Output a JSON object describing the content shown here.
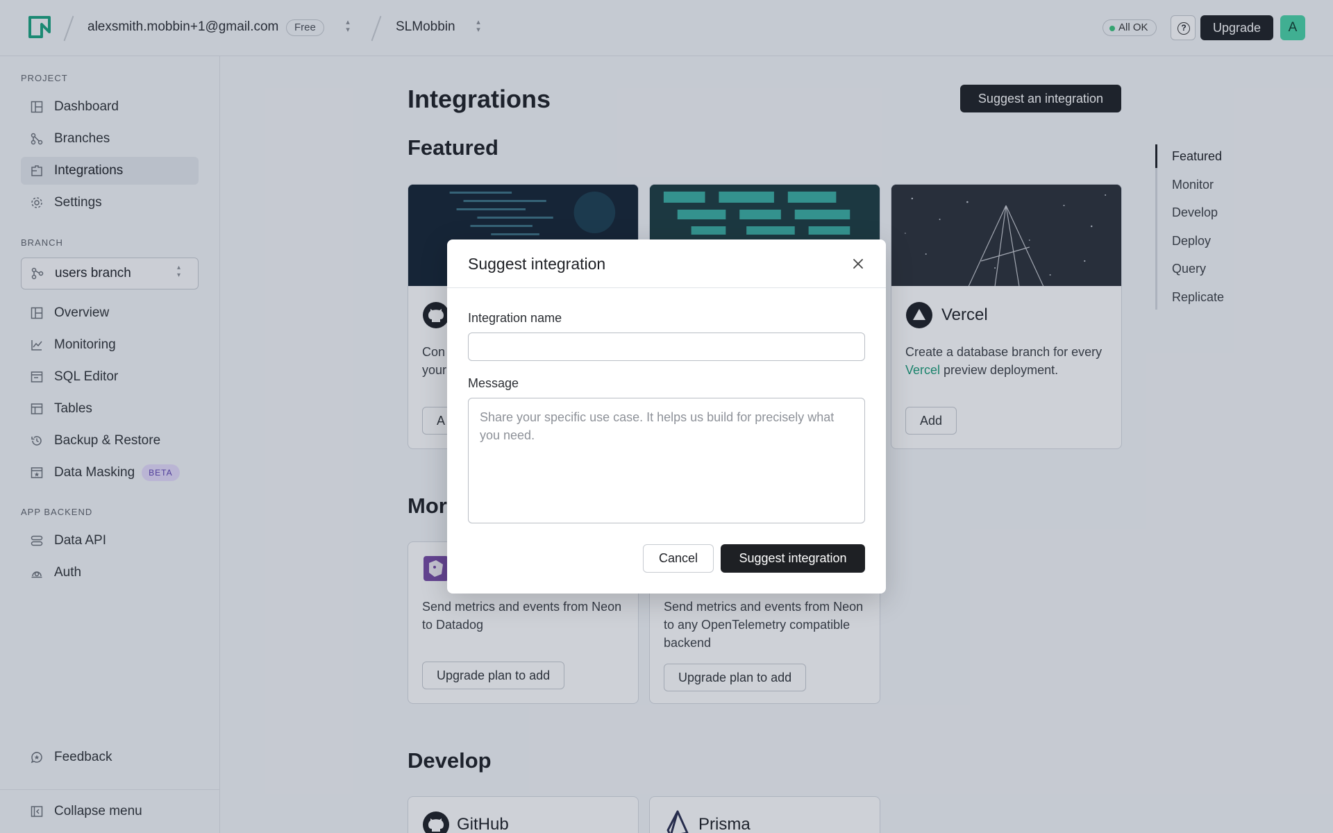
{
  "topbar": {
    "account_email": "alexsmith.mobbin+1@gmail.com",
    "plan_badge": "Free",
    "project_name": "SLMobbin",
    "status": "All OK",
    "upgrade_label": "Upgrade",
    "avatar_initial": "A"
  },
  "sidebar": {
    "project_label": "PROJECT",
    "project_items": [
      {
        "label": "Dashboard",
        "icon": "dashboard-icon"
      },
      {
        "label": "Branches",
        "icon": "branches-icon"
      },
      {
        "label": "Integrations",
        "icon": "integrations-icon",
        "active": true
      },
      {
        "label": "Settings",
        "icon": "gear-icon"
      }
    ],
    "branch_label": "BRANCH",
    "branch_value": "users branch",
    "branch_items": [
      {
        "label": "Overview",
        "icon": "overview-icon"
      },
      {
        "label": "Monitoring",
        "icon": "monitoring-icon"
      },
      {
        "label": "SQL Editor",
        "icon": "sql-editor-icon"
      },
      {
        "label": "Tables",
        "icon": "tables-icon"
      },
      {
        "label": "Backup & Restore",
        "icon": "history-icon"
      },
      {
        "label": "Data Masking",
        "icon": "data-masking-icon",
        "badge": "BETA"
      }
    ],
    "app_backend_label": "APP BACKEND",
    "backend_items": [
      {
        "label": "Data API",
        "icon": "data-api-icon"
      },
      {
        "label": "Auth",
        "icon": "auth-icon"
      }
    ],
    "feedback_label": "Feedback",
    "collapse_label": "Collapse menu"
  },
  "main": {
    "title": "Integrations",
    "suggest_button": "Suggest an integration",
    "featured_title": "Featured",
    "monitor_title_visible": "Mor",
    "develop_title": "Develop",
    "featured_cards": [
      {
        "title": "",
        "desc_line1": "Con",
        "desc_line2": "your",
        "button": "A"
      },
      {
        "title": "",
        "desc": "",
        "button": ""
      },
      {
        "title": "Vercel",
        "desc_prefix": "Create a database branch for every ",
        "desc_link": "Vercel",
        "desc_suffix": " preview deployment.",
        "button": "Add"
      }
    ],
    "monitor_cards": [
      {
        "desc": "Send metrics and events from Neon to Datadog",
        "button": "Upgrade plan to add"
      },
      {
        "desc": "Send metrics and events from Neon to any OpenTelemetry compatible backend",
        "button": "Upgrade plan to add"
      }
    ],
    "develop_cards": [
      {
        "title": "GitHub"
      },
      {
        "title": "Prisma"
      }
    ]
  },
  "toc": {
    "items": [
      "Featured",
      "Monitor",
      "Develop",
      "Deploy",
      "Query",
      "Replicate"
    ]
  },
  "modal": {
    "title": "Suggest integration",
    "name_label": "Integration name",
    "name_value": "",
    "message_label": "Message",
    "message_placeholder": "Share your specific use case. It helps us build for precisely what you need.",
    "cancel_label": "Cancel",
    "submit_label": "Suggest integration"
  },
  "colors": {
    "accent": "#1a9b77",
    "status_ok": "#3cc47c",
    "primary_button": "#1e2024",
    "beta_badge": "#e6dcfb"
  }
}
